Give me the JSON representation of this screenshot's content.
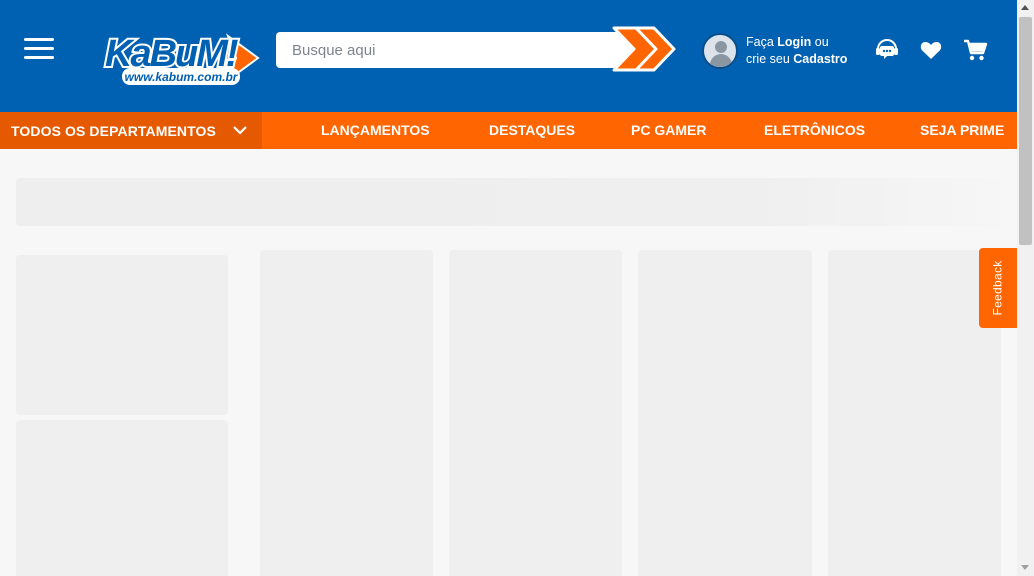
{
  "header": {
    "logo_text": "KaBuM!",
    "logo_url_text": "www.kabum.com.br",
    "search_placeholder": "Busque aqui",
    "login_line1_prefix": "Faça ",
    "login_line1_bold": "Login",
    "login_line1_suffix": " ou",
    "login_line2_prefix": "crie seu ",
    "login_line2_bold": "Cadastro",
    "colors": {
      "primary": "#0060b1",
      "accent": "#ff6500"
    },
    "icons": [
      "menu-icon",
      "search-arrow-icon",
      "user-avatar-icon",
      "support-chat-icon",
      "heart-icon",
      "cart-icon"
    ]
  },
  "nav": {
    "departments_label": "TODOS OS DEPARTAMENTOS",
    "items": [
      {
        "label": "LANÇAMENTOS"
      },
      {
        "label": "DESTAQUES"
      },
      {
        "label": "PC GAMER"
      },
      {
        "label": "ELETRÔNICOS"
      },
      {
        "label": "SEJA PRIME"
      }
    ]
  },
  "feedback_label": "Feedback"
}
